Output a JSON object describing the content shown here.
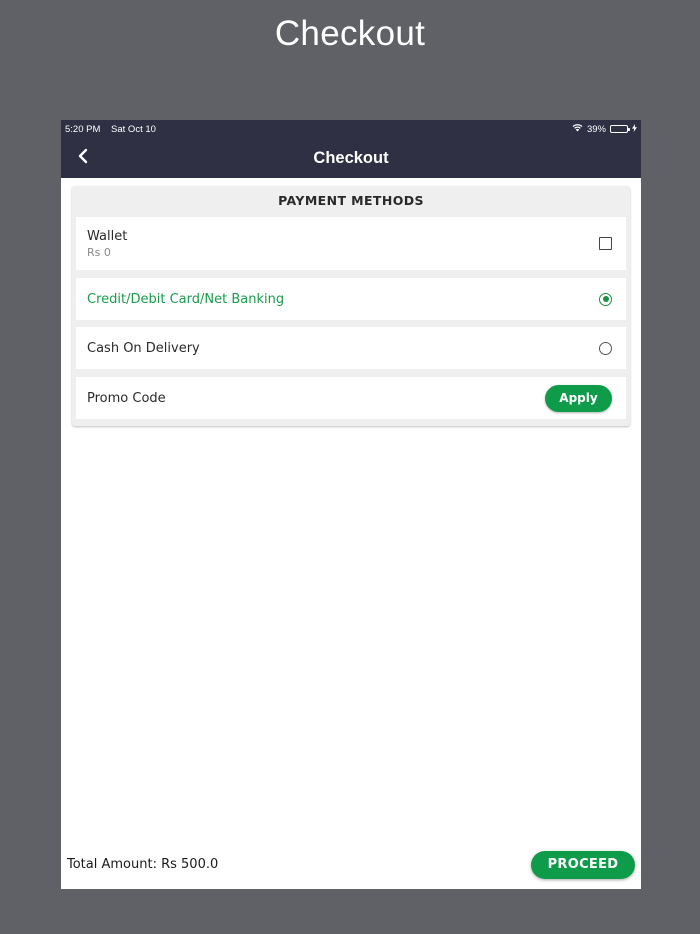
{
  "page_heading": "Checkout",
  "status_bar": {
    "time": "5:20 PM",
    "date": "Sat Oct 10",
    "battery_percent": "39%",
    "battery_level": 0.39,
    "icons": [
      "wifi-icon",
      "battery-icon",
      "charging-bolt-icon"
    ]
  },
  "nav": {
    "title": "Checkout",
    "back_icon": "chevron-left-icon"
  },
  "payment_methods": {
    "header": "PAYMENT METHODS",
    "wallet": {
      "label": "Wallet",
      "balance": "Rs 0",
      "checked": false
    },
    "card": {
      "label": "Credit/Debit Card/Net Banking",
      "selected": true
    },
    "cod": {
      "label": "Cash On Delivery",
      "selected": false
    },
    "promo": {
      "label": "Promo Code",
      "apply_label": "Apply"
    }
  },
  "footer": {
    "total": "Total Amount: Rs 500.0",
    "proceed_label": "PROCEED"
  },
  "colors": {
    "background": "#606166",
    "nav_bar": "#2f3044",
    "accent_green": "#0e9c4a",
    "selected_text": "#1a9c4c"
  }
}
